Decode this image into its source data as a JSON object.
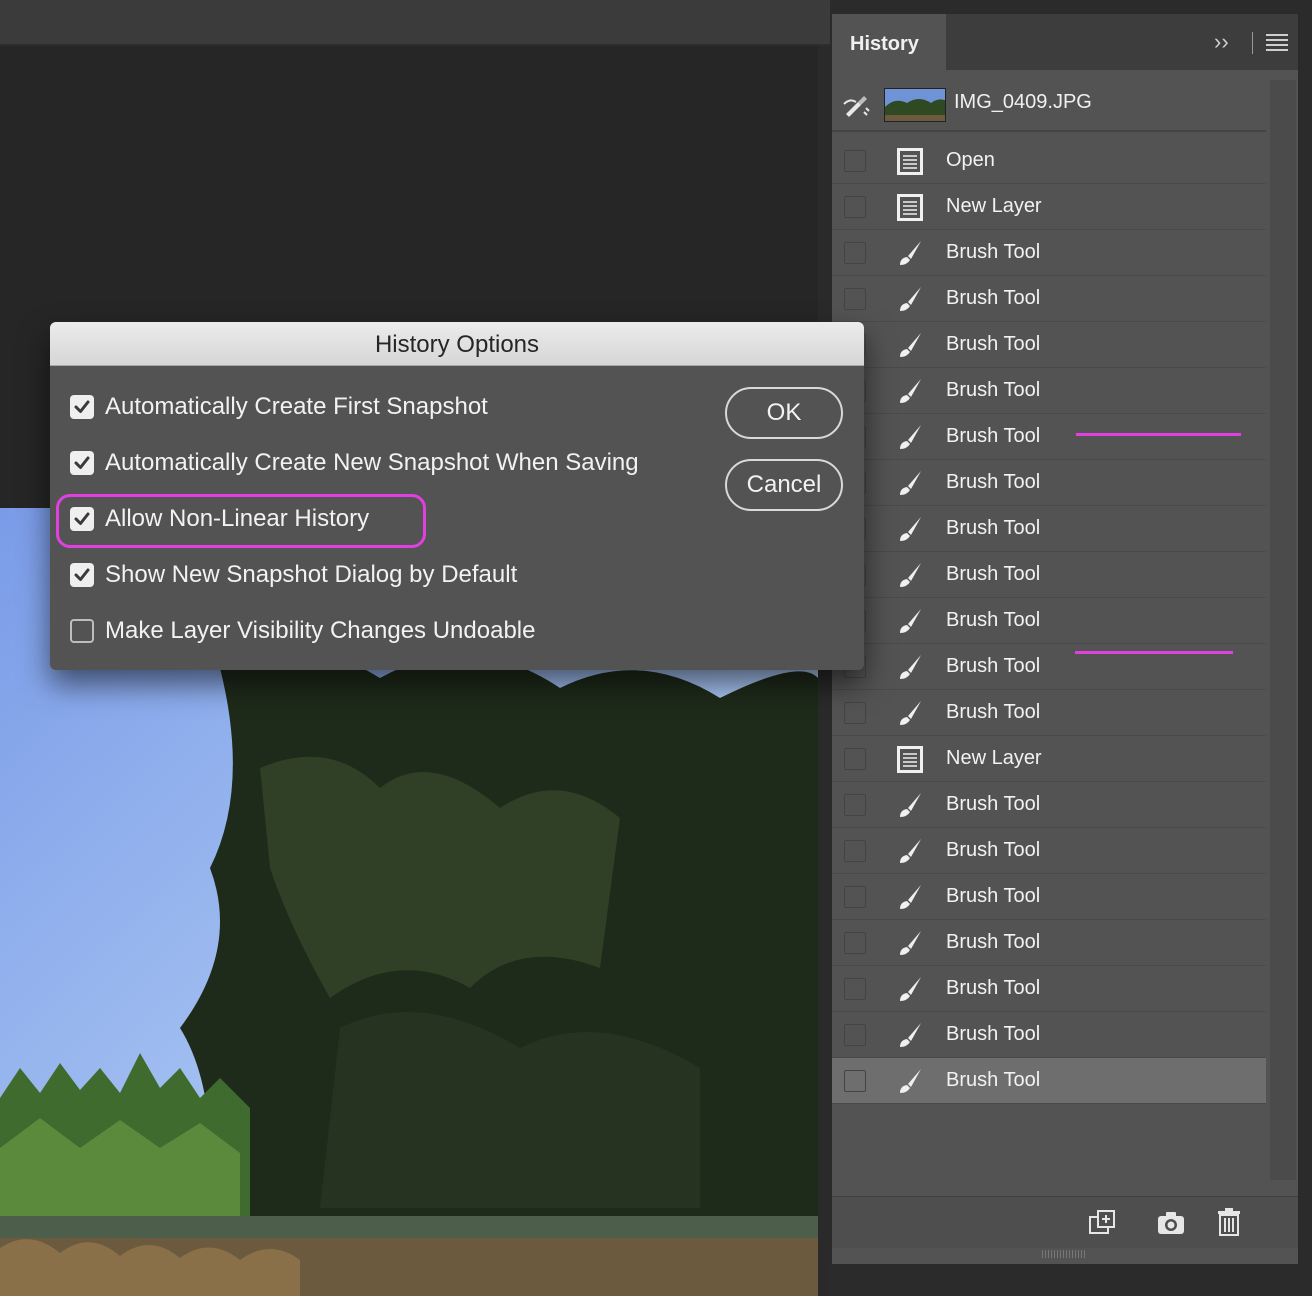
{
  "panel": {
    "tab_label": "History",
    "collapse_label": "››",
    "snapshot": {
      "name": "IMG_0409.JPG"
    },
    "steps": [
      {
        "label": "Open",
        "icon": "document-icon",
        "selected": false
      },
      {
        "label": "New Layer",
        "icon": "document-icon",
        "selected": false
      },
      {
        "label": "Brush Tool",
        "icon": "brush-icon",
        "selected": false
      },
      {
        "label": "Brush Tool",
        "icon": "brush-icon",
        "selected": false
      },
      {
        "label": "Brush Tool",
        "icon": "brush-icon",
        "selected": false
      },
      {
        "label": "Brush Tool",
        "icon": "brush-icon",
        "selected": false
      },
      {
        "label": "Brush Tool",
        "icon": "brush-icon",
        "selected": false
      },
      {
        "label": "Brush Tool",
        "icon": "brush-icon",
        "selected": false
      },
      {
        "label": "Brush Tool",
        "icon": "brush-icon",
        "selected": false
      },
      {
        "label": "Brush Tool",
        "icon": "brush-icon",
        "selected": false
      },
      {
        "label": "Brush Tool",
        "icon": "brush-icon",
        "selected": false
      },
      {
        "label": "Brush Tool",
        "icon": "brush-icon",
        "selected": false
      },
      {
        "label": "Brush Tool",
        "icon": "brush-icon",
        "selected": false
      },
      {
        "label": "New Layer",
        "icon": "document-icon",
        "selected": false
      },
      {
        "label": "Brush Tool",
        "icon": "brush-icon",
        "selected": false
      },
      {
        "label": "Brush Tool",
        "icon": "brush-icon",
        "selected": false
      },
      {
        "label": "Brush Tool",
        "icon": "brush-icon",
        "selected": false
      },
      {
        "label": "Brush Tool",
        "icon": "brush-icon",
        "selected": false
      },
      {
        "label": "Brush Tool",
        "icon": "brush-icon",
        "selected": false
      },
      {
        "label": "Brush Tool",
        "icon": "brush-icon",
        "selected": false
      },
      {
        "label": "Brush Tool",
        "icon": "brush-icon",
        "selected": true
      }
    ],
    "footer": {
      "new_document_icon": "new-document-from-state-icon",
      "snapshot_icon": "camera-icon",
      "delete_icon": "trash-icon"
    }
  },
  "dialog": {
    "title": "History Options",
    "options": [
      {
        "label": "Automatically Create First Snapshot",
        "checked": true
      },
      {
        "label": "Automatically Create New Snapshot When Saving",
        "checked": true
      },
      {
        "label": "Allow Non-Linear History",
        "checked": true
      },
      {
        "label": "Show New Snapshot Dialog by Default",
        "checked": true
      },
      {
        "label": "Make Layer Visibility Changes Undoable",
        "checked": false
      }
    ],
    "ok_label": "OK",
    "cancel_label": "Cancel"
  },
  "colors": {
    "annotation": "#e040e0",
    "panel_bg": "#535353",
    "selected_row": "#6e6e6e"
  }
}
